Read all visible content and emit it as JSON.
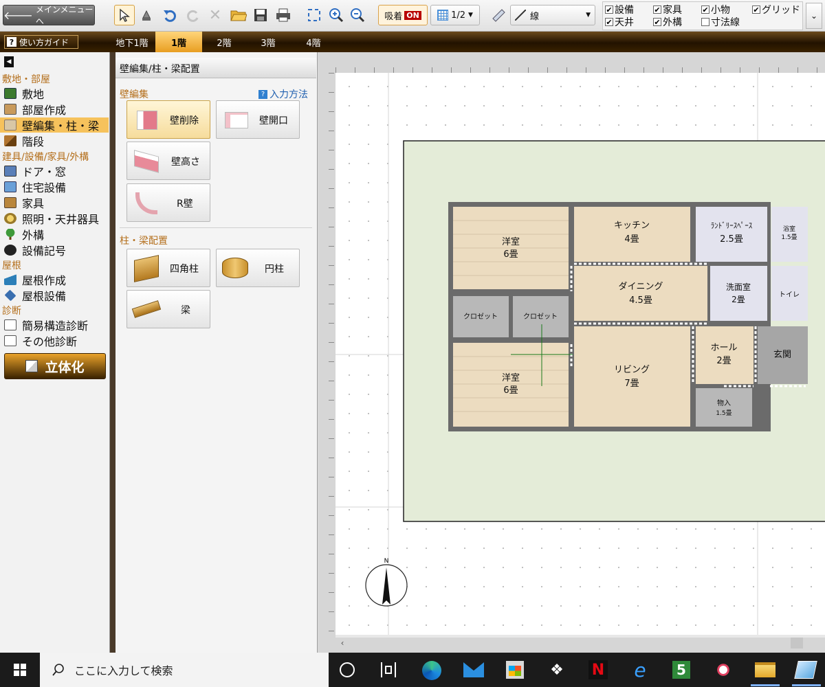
{
  "toolbar": {
    "main_menu": "メインメニューへ",
    "snap_label": "吸着",
    "snap_state": "ON",
    "grid_ratio": "1/2",
    "line_type": "線",
    "checks": [
      {
        "label": "設備",
        "checked": true
      },
      {
        "label": "家具",
        "checked": true
      },
      {
        "label": "小物",
        "checked": true
      },
      {
        "label": "グリッド",
        "checked": true
      },
      {
        "label": "天井",
        "checked": true
      },
      {
        "label": "外構",
        "checked": true
      },
      {
        "label": "寸法線",
        "checked": false
      }
    ]
  },
  "floors": {
    "guide": "使い方ガイド",
    "tabs": [
      "地下1階",
      "1階",
      "2階",
      "3階",
      "4階"
    ],
    "active": "1階"
  },
  "sidebar": {
    "sections": [
      {
        "title": "敷地・部屋",
        "items": [
          "敷地",
          "部屋作成",
          "壁編集・柱・梁",
          "階段"
        ]
      },
      {
        "title": "建具/設備/家具/外構",
        "items": [
          "ドア・窓",
          "住宅設備",
          "家具",
          "照明・天井器具",
          "外構",
          "設備記号"
        ]
      },
      {
        "title": "屋根",
        "items": [
          "屋根作成",
          "屋根設備"
        ]
      },
      {
        "title": "診断",
        "items": [
          "簡易構造診断",
          "その他診断"
        ]
      }
    ],
    "selected": "壁編集・柱・梁",
    "render_button": "立体化"
  },
  "panel": {
    "title": "壁編集/柱・梁配置",
    "wall_section": "壁編集",
    "help": "入力方法",
    "wall_buttons": [
      "壁削除",
      "壁開口",
      "壁高さ",
      "R壁"
    ],
    "column_section": "柱・梁配置",
    "column_buttons": [
      "四角柱",
      "円柱",
      "梁"
    ]
  },
  "floorplan": {
    "rooms": [
      {
        "name": "洋室",
        "size": "6畳"
      },
      {
        "name": "キッチン",
        "size": "4畳"
      },
      {
        "name": "ﾗﾝﾄﾞﾘｰｽﾍﾟｰｽ",
        "size": "2.5畳"
      },
      {
        "name": "浴室",
        "size": "1.5畳"
      },
      {
        "name": "ダイニング",
        "size": "4.5畳"
      },
      {
        "name": "洗面室",
        "size": "2畳"
      },
      {
        "name": "トイレ",
        "size": ""
      },
      {
        "name": "クロゼット",
        "size": ""
      },
      {
        "name": "クロゼット",
        "size": ""
      },
      {
        "name": "洋室",
        "size": "6畳"
      },
      {
        "name": "リビング",
        "size": "7畳"
      },
      {
        "name": "ホール",
        "size": "2畳"
      },
      {
        "name": "玄関",
        "size": ""
      },
      {
        "name": "物入",
        "size": "1.5畳"
      }
    ],
    "compass": "N"
  },
  "taskbar": {
    "search_placeholder": "ここに入力して検索"
  },
  "colors": {
    "accent": "#f6c25c",
    "site": "#e4ecd8",
    "wall": "#6b6b6b",
    "wood": "#ecdcc0",
    "tile": "#e2e2ec"
  }
}
